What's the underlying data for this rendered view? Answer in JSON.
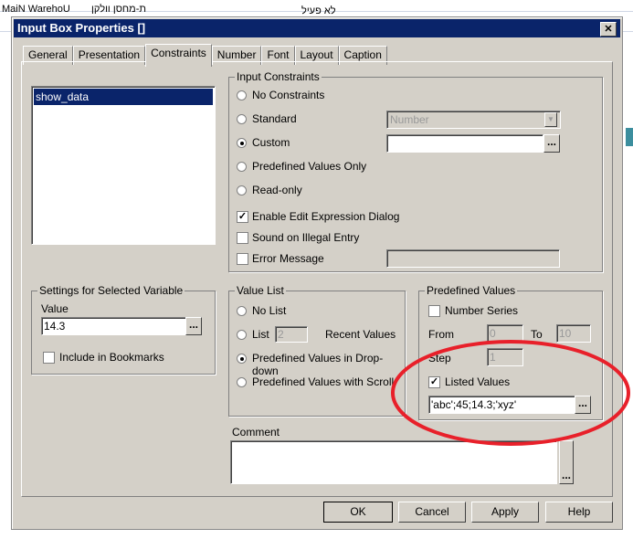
{
  "background": {
    "cells": [
      "MaiN WarehoU",
      "ת-מחסן וולקן",
      "לא פעיל"
    ]
  },
  "dialog": {
    "title": "Input Box Properties []",
    "tabs": [
      "General",
      "Presentation",
      "Constraints",
      "Number",
      "Font",
      "Layout",
      "Caption"
    ],
    "variables": [
      "show_data"
    ],
    "settings": {
      "legend": "Settings for Selected Variable",
      "value_label": "Value",
      "value": "14.3",
      "include_bookmarks": "Include in Bookmarks"
    },
    "input_constraints": {
      "legend": "Input Constraints",
      "no_constraints": "No Constraints",
      "standard": "Standard",
      "standard_select": "Number",
      "custom": "Custom",
      "custom_value": "",
      "predefined_only": "Predefined Values Only",
      "read_only": "Read-only",
      "enable_edit": "Enable Edit Expression Dialog",
      "sound": "Sound on Illegal Entry",
      "error_message": "Error Message"
    },
    "value_list": {
      "legend": "Value List",
      "no_list": "No List",
      "list": "List",
      "list_count": "2",
      "recent_values": "Recent Values",
      "drop_down": "Predefined Values in Drop-down",
      "with_scroll": "Predefined Values with Scroll"
    },
    "predefined": {
      "legend": "Predefined Values",
      "number_series": "Number Series",
      "from_label": "From",
      "from": "0",
      "to_label": "To",
      "to": "10",
      "step_label": "Step",
      "step": "1",
      "listed_values": "Listed Values",
      "listed_value": "'abc';45;14.3;'xyz'"
    },
    "comment": {
      "label": "Comment",
      "value": ""
    },
    "buttons": {
      "ok": "OK",
      "cancel": "Cancel",
      "apply": "Apply",
      "help": "Help",
      "dots": "..."
    },
    "annotation_color": "#e8202a"
  }
}
